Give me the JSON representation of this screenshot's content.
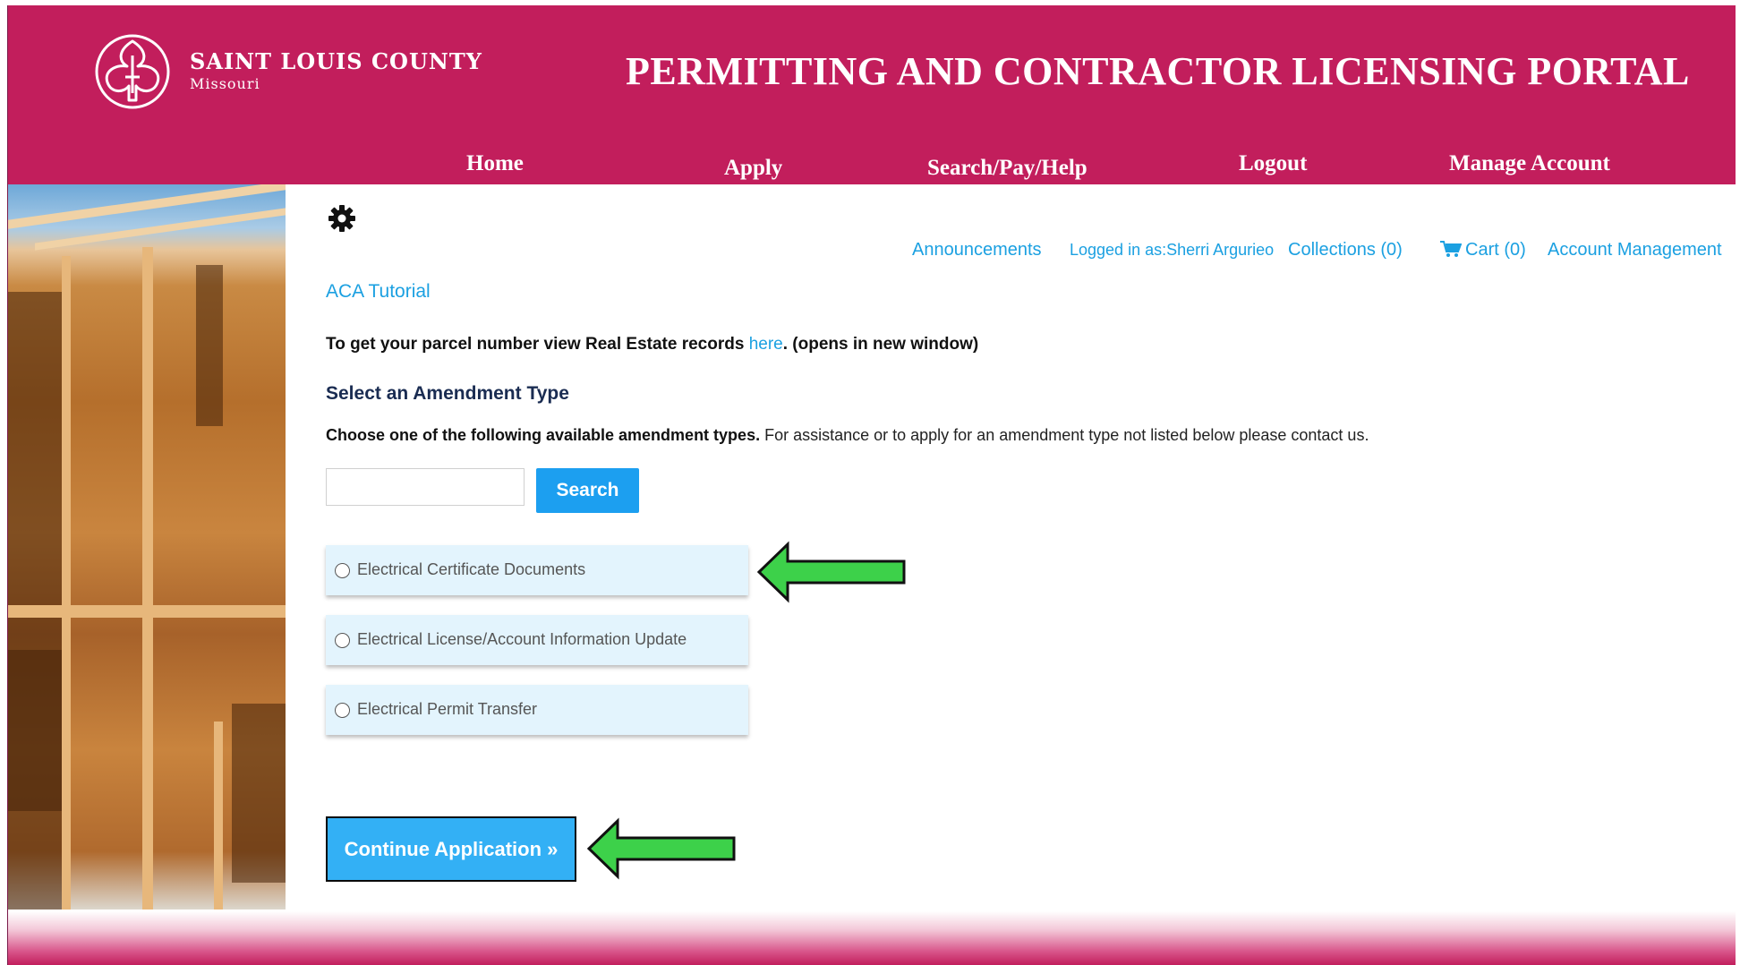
{
  "header": {
    "brand_name": "SAINT LOUIS COUNTY",
    "brand_state": "Missouri",
    "portal_title": "PERMITTING AND CONTRACTOR LICENSING PORTAL",
    "background_color": "#c21e5c",
    "nav": [
      {
        "label": "Home"
      },
      {
        "label": "Apply"
      },
      {
        "label": "Search/Pay/Help"
      },
      {
        "label": "Logout"
      },
      {
        "label": "Manage Account"
      }
    ]
  },
  "utility_links": {
    "announcements": "Announcements",
    "logged_in": "Logged in as:Sherri Argurieo",
    "collections": "Collections (0)",
    "cart": "Cart (0)",
    "account_management": "Account Management"
  },
  "tutorial_link": "ACA Tutorial",
  "parcel": {
    "prefix": "To get your parcel number view Real Estate records ",
    "link": "here",
    "suffix": ". (opens in new window)"
  },
  "section_title": "Select an Amendment Type",
  "instructions": {
    "bold": "Choose one of the following available amendment types.",
    "rest": " For assistance or to apply for an amendment type not listed below please contact us."
  },
  "search": {
    "input_value": "",
    "button_label": "Search"
  },
  "amendment_options": [
    {
      "label": "Electrical Certificate Documents",
      "selected": false
    },
    {
      "label": "Electrical License/Account Information Update",
      "selected": false
    },
    {
      "label": "Electrical Permit Transfer",
      "selected": false
    }
  ],
  "continue_button": "Continue Application »",
  "colors": {
    "accent": "#1ba0e1",
    "button": "#1c9ff0",
    "annotation_arrow": "#3dd14a"
  }
}
